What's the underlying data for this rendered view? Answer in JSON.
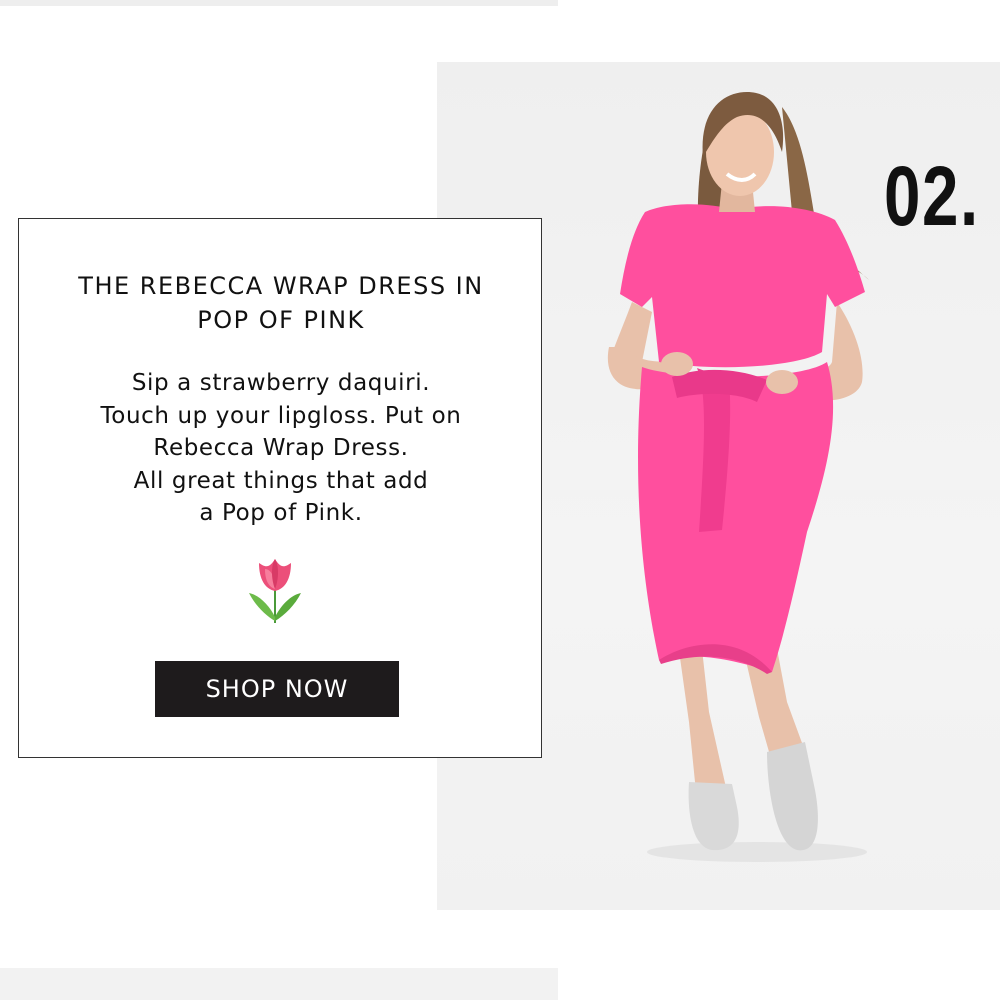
{
  "slide": {
    "number": "02."
  },
  "promo": {
    "title": "THE REBECCA WRAP DRESS IN POP OF PINK",
    "body_lines": [
      "Sip a strawberry daquiri.",
      "Touch up your lipgloss. Put on",
      "Rebecca Wrap Dress.",
      "All great things that add",
      "a Pop of Pink."
    ],
    "icon": "tulip-icon",
    "cta_label": "SHOP NOW"
  },
  "colors": {
    "dress_pink": "#ff4f9e",
    "button_bg": "#1e1b1c",
    "panel_bg": "#efefef"
  }
}
